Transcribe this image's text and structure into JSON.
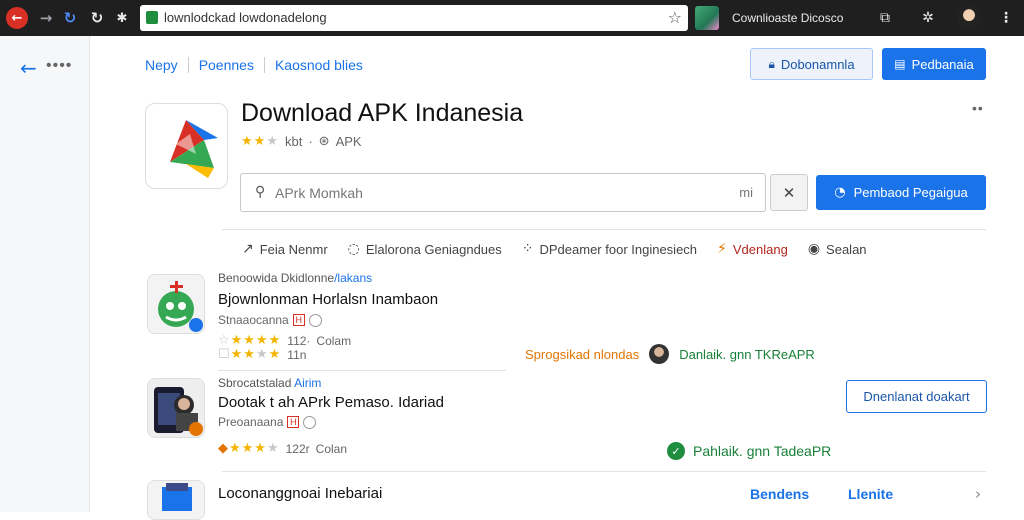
{
  "browser": {
    "url": "lownlodckad lowdonadelong",
    "profile_label": "Cownlioaste Dicosco",
    "star_glyph": "☆"
  },
  "nav": {
    "items": [
      "Nepy",
      "Poennes",
      "Kaosnod blies"
    ],
    "outline_button": "Dobonamnla",
    "primary_button": "Pedbanaia"
  },
  "app": {
    "title": "Download APK Indanesia",
    "meta_text": "kbt",
    "meta_tag": "APK"
  },
  "search": {
    "placeholder": "APrk Momkah",
    "tail": "mi",
    "clear": "✕",
    "action_button": "Pembaod Pegaigua"
  },
  "categories": [
    {
      "label": "Feia Nenmr",
      "icon": "share-arrow-icon"
    },
    {
      "label": "Elalorona Geniagndues",
      "icon": "globe-icon"
    },
    {
      "label": "DPdeamer foor Inginesiech",
      "icon": "dots-icon"
    },
    {
      "label": "Vdenlang",
      "icon": "fire-icon"
    },
    {
      "label": "Sealan",
      "icon": "compass-icon"
    }
  ],
  "items": [
    {
      "category_prefix": "Benoowida Dkidlonne",
      "category_highlight": "/lakans",
      "title": "Bjownlonman Horlalsn Inambaon",
      "sub": "Stnaaocanna",
      "rating_a": "112·",
      "rating_a_suffix": "Colam",
      "rating_b": "11n"
    },
    {
      "category_prefix": "Sbrocatstalad",
      "category_highlight": "Airim",
      "title": "Dootak t ah APrk Pemaso. Idariad",
      "sub": "Preoanaana",
      "rating_a": "122r",
      "rating_a_suffix": "Colan"
    },
    {
      "title": "Loconanggnoai Inebariai"
    }
  ],
  "promo": {
    "text": "Sprogsikad nlondas",
    "download": "Danlaik. gnn TKReAPR"
  },
  "download_ok": "Pahlaik. gnn TadeaPR",
  "download_button": "Dnenlanat doakart",
  "bottom_links": [
    "Bendens",
    "Llenite"
  ]
}
